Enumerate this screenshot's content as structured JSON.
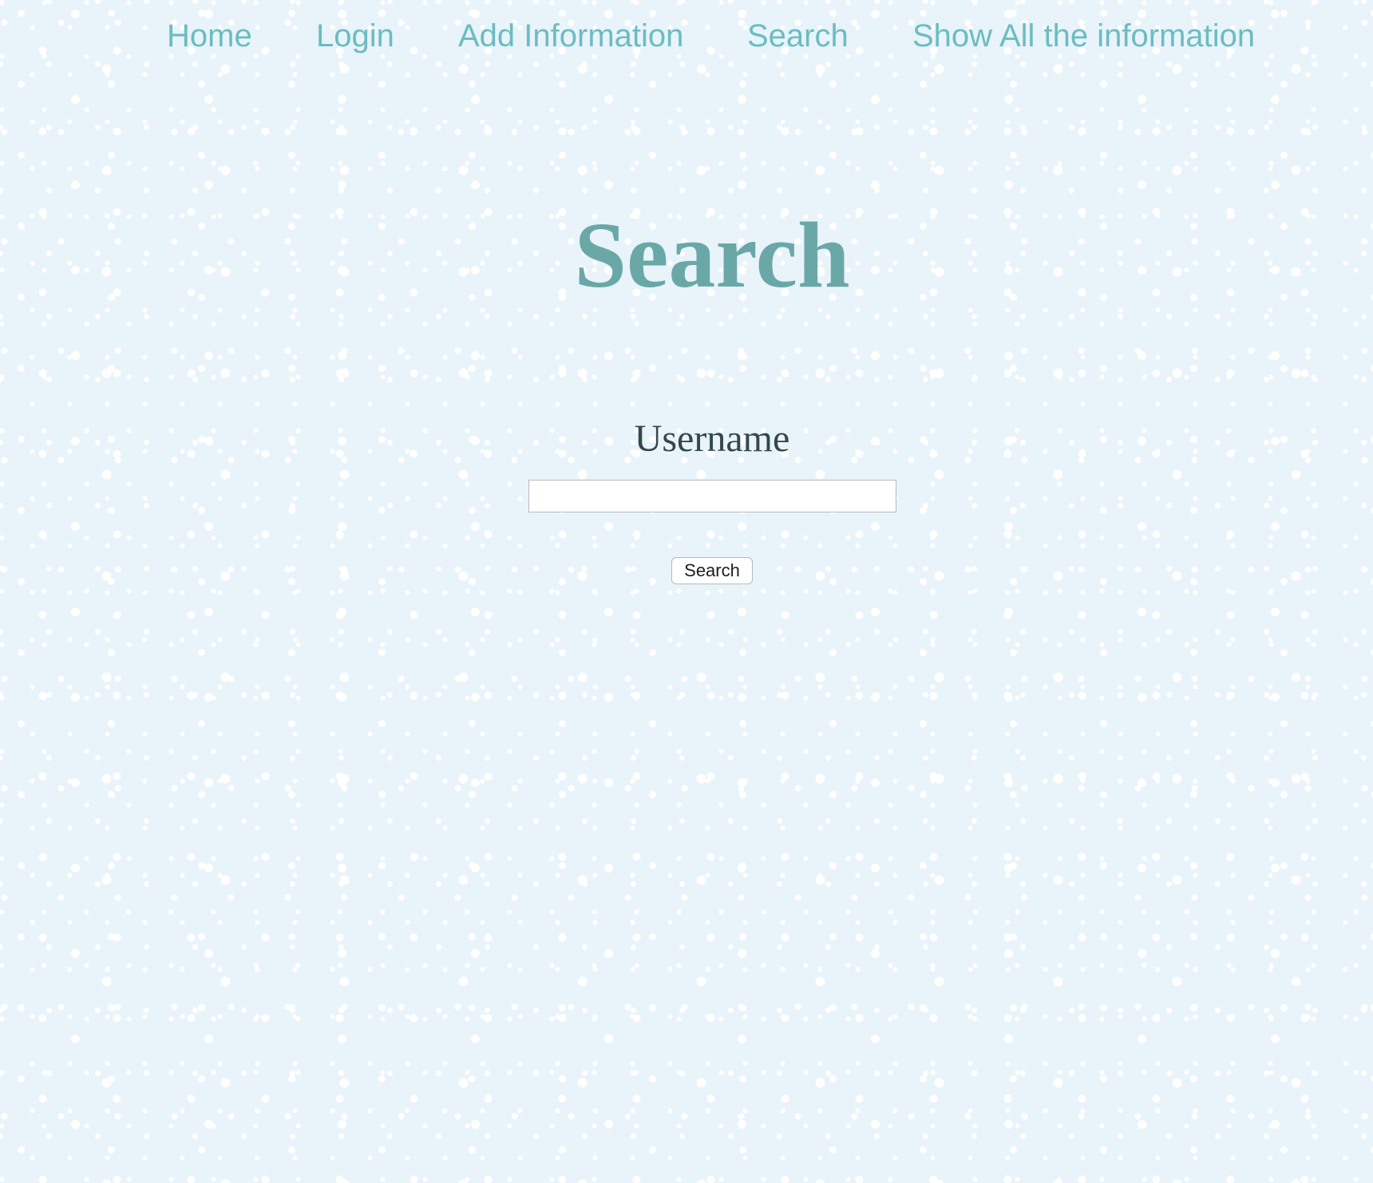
{
  "nav": {
    "home": "Home",
    "login": "Login",
    "add_information": "Add Information",
    "search": "Search",
    "show_all": "Show All the information"
  },
  "main": {
    "title": "Search",
    "form": {
      "username_label": "Username",
      "username_value": "",
      "submit_label": "Search"
    }
  },
  "colors": {
    "background": "#e8f3fa",
    "nav_link": "#6bbdc1",
    "title": "#6aa8a8",
    "label": "#34484a"
  }
}
